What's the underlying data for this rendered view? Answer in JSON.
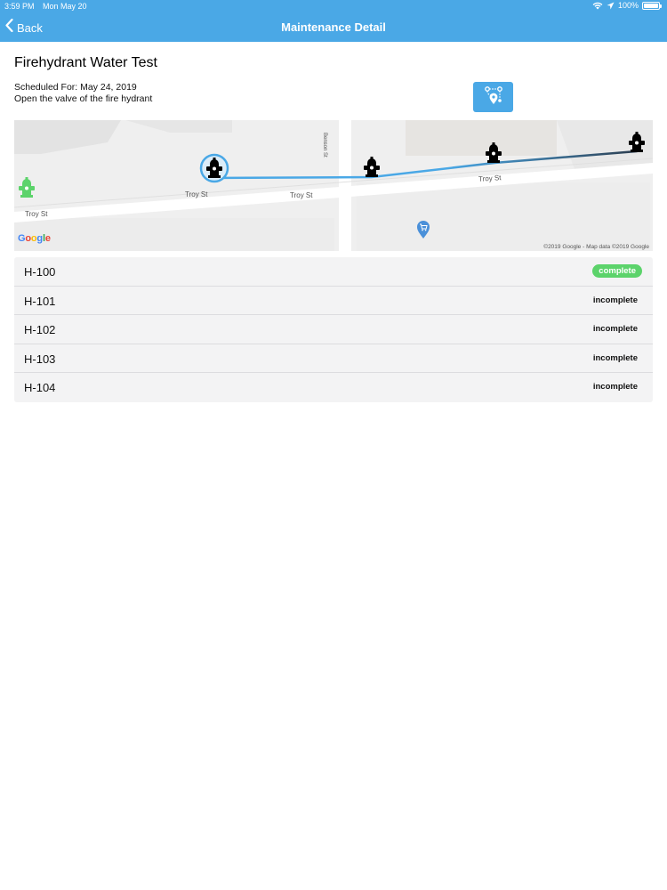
{
  "status_bar": {
    "time": "3:59 PM",
    "date": "Mon May 20",
    "battery": "100%",
    "icons": [
      "wifi-icon",
      "location-arrow-icon",
      "battery-icon"
    ]
  },
  "nav": {
    "back_label": "Back",
    "title": "Maintenance Detail",
    "icons": [
      "chevron-left-icon"
    ]
  },
  "task": {
    "title": "Firehydrant Water Test",
    "scheduled": "Scheduled For: May 24, 2019",
    "description": "Open the valve of the fire hydrant",
    "route_button_icon": "route-map-icon"
  },
  "map": {
    "street_labels": [
      "Troy St",
      "Troy St",
      "Troy St",
      "Troy St",
      "Benson St"
    ],
    "logo": "Google",
    "attribution": "©2019 Google - Map data ©2019 Google",
    "marker_icons": [
      "hydrant-icon",
      "shopping-cart-pin-icon"
    ],
    "colors": {
      "route_start": "#4aa8e6",
      "route_end": "#2c3e50",
      "complete_marker": "#5cd36b",
      "pin": "#4a90d9"
    }
  },
  "hydrants": [
    {
      "name": "H-100",
      "status": "complete"
    },
    {
      "name": "H-101",
      "status": "incomplete"
    },
    {
      "name": "H-102",
      "status": "incomplete"
    },
    {
      "name": "H-103",
      "status": "incomplete"
    },
    {
      "name": "H-104",
      "status": "incomplete"
    }
  ],
  "colors": {
    "accent": "#4aa8e6",
    "complete_badge": "#5cd36b"
  }
}
